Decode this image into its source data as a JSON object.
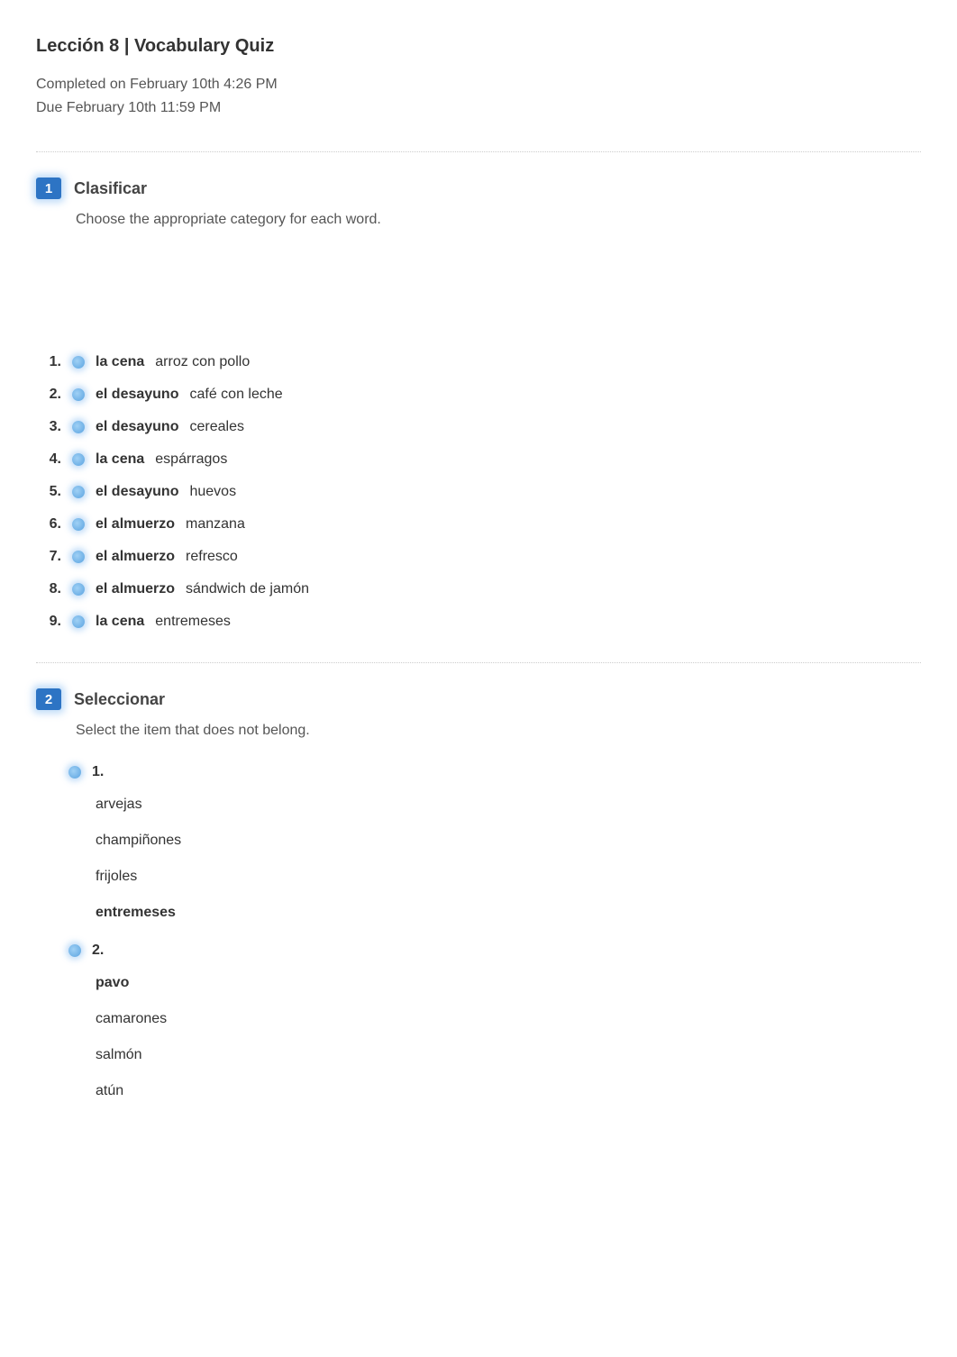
{
  "header": {
    "title": "Lección 8 | Vocabulary Quiz",
    "completed": "Completed on February 10th 4:26 PM",
    "due": "Due February 10th 11:59 PM"
  },
  "section1": {
    "number": "1",
    "title": "Clasificar",
    "desc": "Choose the appropriate category for each word.",
    "items": [
      {
        "n": "1.",
        "answer": "la cena",
        "word": "arroz con pollo"
      },
      {
        "n": "2.",
        "answer": "el desayuno",
        "word": "café con leche"
      },
      {
        "n": "3.",
        "answer": "el desayuno",
        "word": "cereales"
      },
      {
        "n": "4.",
        "answer": "la cena",
        "word": "espárragos"
      },
      {
        "n": "5.",
        "answer": "el desayuno",
        "word": "huevos"
      },
      {
        "n": "6.",
        "answer": "el almuerzo",
        "word": "manzana"
      },
      {
        "n": "7.",
        "answer": "el almuerzo",
        "word": "refresco"
      },
      {
        "n": "8.",
        "answer": "el almuerzo",
        "word": "sándwich de jamón"
      },
      {
        "n": "9.",
        "answer": "la cena",
        "word": "entremeses"
      }
    ]
  },
  "section2": {
    "number": "2",
    "title": "Seleccionar",
    "desc": "Select the item that does not belong.",
    "questions": [
      {
        "n": "1.",
        "options": [
          {
            "text": "arvejas",
            "sel": false
          },
          {
            "text": "champiñones",
            "sel": false
          },
          {
            "text": "frijoles",
            "sel": false
          },
          {
            "text": "entremeses",
            "sel": true
          }
        ]
      },
      {
        "n": "2.",
        "options": [
          {
            "text": "pavo",
            "sel": true
          },
          {
            "text": "camarones",
            "sel": false
          },
          {
            "text": "salmón",
            "sel": false
          },
          {
            "text": "atún",
            "sel": false
          }
        ]
      }
    ]
  }
}
